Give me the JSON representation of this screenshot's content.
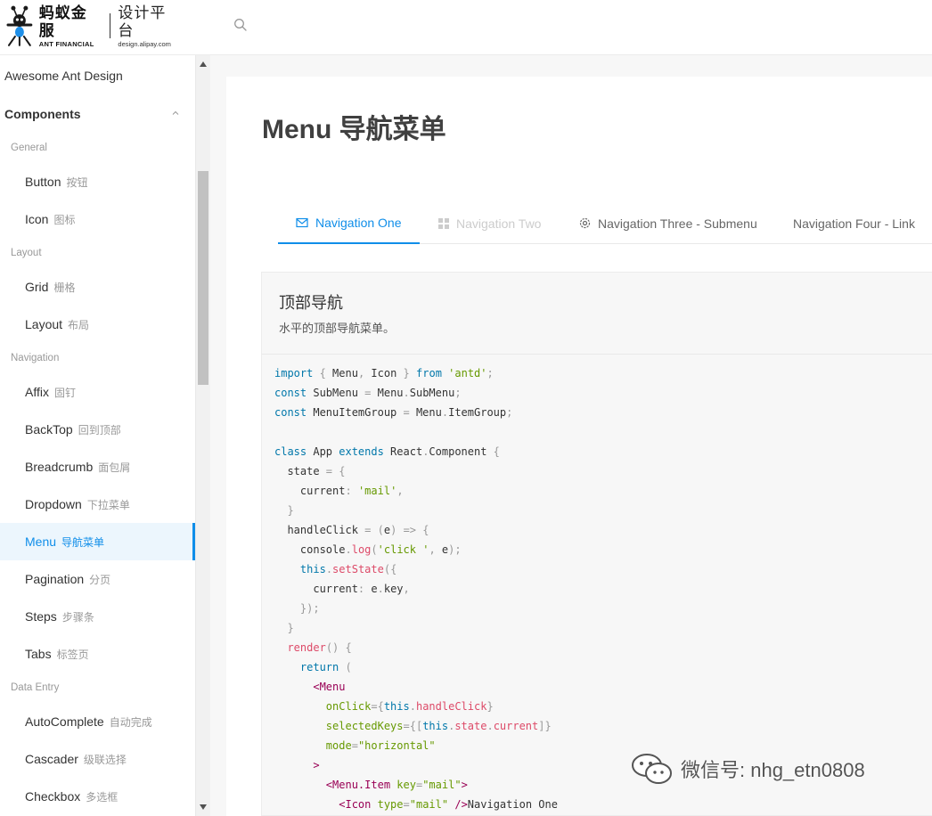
{
  "header": {
    "logo_cn": "蚂蚁金服",
    "logo_en": "ANT FINANCIAL",
    "design_cn": "设计平台",
    "design_url": "design.alipay.com"
  },
  "sidebar": {
    "top_item": "Awesome Ant Design",
    "submenu_title": "Components",
    "groups": [
      {
        "title": "General",
        "items": [
          {
            "label": "Button",
            "sub": "按钮"
          },
          {
            "label": "Icon",
            "sub": "图标"
          }
        ]
      },
      {
        "title": "Layout",
        "items": [
          {
            "label": "Grid",
            "sub": "栅格"
          },
          {
            "label": "Layout",
            "sub": "布局"
          }
        ]
      },
      {
        "title": "Navigation",
        "items": [
          {
            "label": "Affix",
            "sub": "固钉"
          },
          {
            "label": "BackTop",
            "sub": "回到顶部"
          },
          {
            "label": "Breadcrumb",
            "sub": "面包屑"
          },
          {
            "label": "Dropdown",
            "sub": "下拉菜单"
          },
          {
            "label": "Menu",
            "sub": "导航菜单"
          },
          {
            "label": "Pagination",
            "sub": "分页"
          },
          {
            "label": "Steps",
            "sub": "步骤条"
          },
          {
            "label": "Tabs",
            "sub": "标签页"
          }
        ]
      },
      {
        "title": "Data Entry",
        "items": [
          {
            "label": "AutoComplete",
            "sub": "自动完成"
          },
          {
            "label": "Cascader",
            "sub": "级联选择"
          },
          {
            "label": "Checkbox",
            "sub": "多选框"
          }
        ]
      }
    ]
  },
  "main": {
    "title": "Menu 导航菜单",
    "nav": [
      {
        "label": "Navigation One"
      },
      {
        "label": "Navigation Two"
      },
      {
        "label": "Navigation Three - Submenu"
      },
      {
        "label": "Navigation Four - Link"
      }
    ],
    "demo": {
      "title": "顶部导航",
      "description": "水平的顶部导航菜单。"
    }
  },
  "watermark": "微信号: nhg_etn0808",
  "colors": {
    "accent": "#108ee9",
    "selected_bg": "#ecf6fd"
  }
}
